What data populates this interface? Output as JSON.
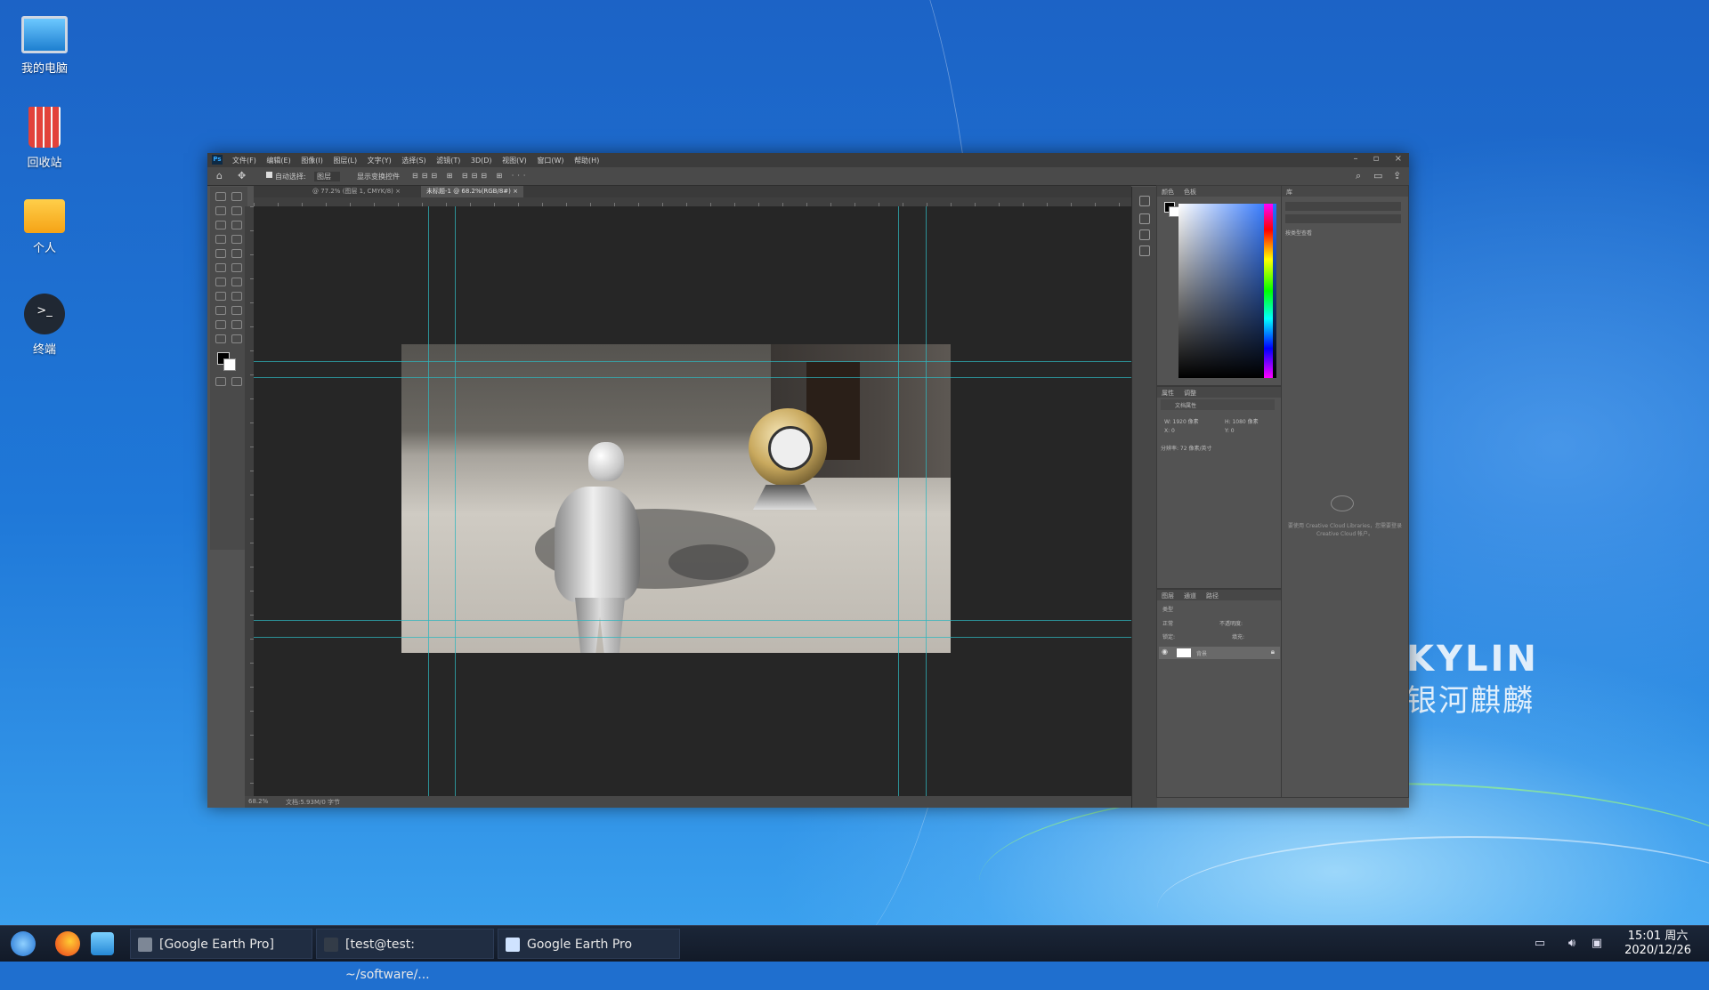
{
  "desktop": {
    "icons": [
      {
        "label": "我的电脑"
      },
      {
        "label": "回收站"
      },
      {
        "label": "个人"
      },
      {
        "label": "终端"
      }
    ],
    "brand": {
      "latin": "KYLIN",
      "chinese": "银河麒麟"
    }
  },
  "photoshop": {
    "app_logo": "Ps",
    "menus": [
      "文件(F)",
      "编辑(E)",
      "图像(I)",
      "图层(L)",
      "文字(Y)",
      "选择(S)",
      "滤镜(T)",
      "3D(D)",
      "视图(V)",
      "窗口(W)",
      "帮助(H)"
    ],
    "options": {
      "auto_select": "自动选择:",
      "auto_select_value": "图层",
      "show_transform": "显示变换控件"
    },
    "tabs": [
      {
        "label": "@ 77.2% (图层 1, CMYK/8)"
      },
      {
        "label": "未标题-1 @ 68.2%(RGB/8#)"
      }
    ],
    "status": {
      "zoom": "68.2%",
      "doc_size": "文档:5.93M/0 字节"
    },
    "color_panel": {
      "tabs": [
        "颜色",
        "色板"
      ]
    },
    "properties_panel": {
      "tabs": [
        "属性",
        "调整"
      ],
      "section": "文档属性",
      "w": "W: 1920 像素",
      "h": "H: 1080 像素",
      "x": "X: 0",
      "y": "Y: 0",
      "resolution": "分辨率: 72 像素/英寸"
    },
    "layers_panel": {
      "tabs": [
        "图层",
        "通道",
        "路径"
      ],
      "kind": "类型",
      "blend": "正常",
      "opacity": "不透明度:",
      "lock": "锁定:",
      "fill": "填充:",
      "layer_name": "背景"
    },
    "libraries_panel": {
      "tab": "库",
      "view_by": "按类型查看",
      "message": "要使用 Creative Cloud Libraries，您需要登录 Creative Cloud 帐户。"
    }
  },
  "taskbar": {
    "windows": [
      {
        "label": "[Google Earth Pro]"
      },
      {
        "label": "[test@test: ~/software/..."
      },
      {
        "label": "Google Earth Pro"
      }
    ],
    "clock": {
      "time": "15:01 周六",
      "date": "2020/12/26"
    }
  },
  "colors": {
    "desktop_blue": "#1f6fcf",
    "guide": "#2fb5bd",
    "ps_panel": "#535353"
  }
}
